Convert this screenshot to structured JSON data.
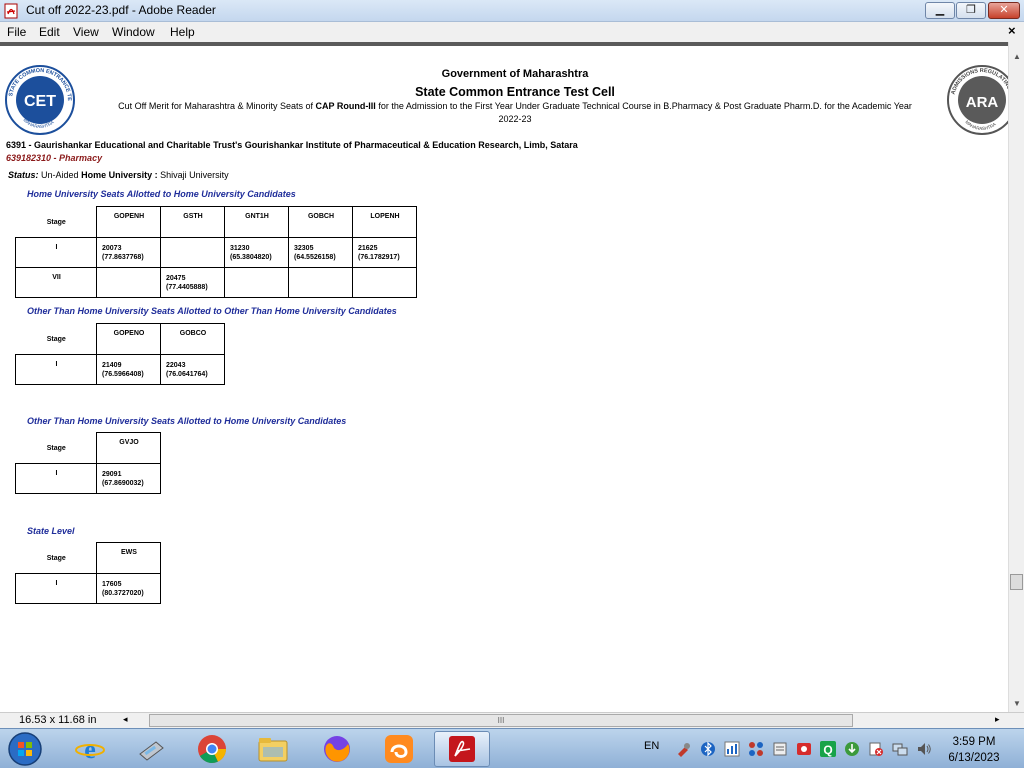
{
  "window": {
    "title": "Cut off 2022-23.pdf - Adobe Reader",
    "minimize": "▁",
    "maximize": "❐",
    "close": "✕"
  },
  "menu": [
    "File",
    "Edit",
    "View",
    "Window",
    "Help"
  ],
  "doc_close": "×",
  "document": {
    "header": {
      "gov": "Government of Maharashtra",
      "cell": "State Common Entrance Test Cell",
      "subtitle_pre": "Cut Off Merit for Maharashtra & Minority Seats of ",
      "subtitle_bold": "CAP Round-III",
      "subtitle_post": " for the Admission to the First Year Under Graduate Technical Course in B.Pharmacy & Post Graduate Pharm.D. for the Academic Year 2022-23"
    },
    "logos": {
      "left_text": "STATE COMMON ENTRANCE TEST CELL",
      "left_mark": "CET",
      "left_bottom": "MAHARASHTRA",
      "right_text": "ADMISSIONS REGULATING",
      "right_mark": "ARA",
      "right_bottom": "MAHARASHTRA"
    },
    "institute": "6391 - Gaurishankar Educational and Charitable Trust's Gourishankar Institute of Pharmaceutical & Education Research, Limb, Satara",
    "course": "639182310 - Pharmacy",
    "status_label": "Status:",
    "status_value": "Un-Aided",
    "home_uni_label": "Home University :",
    "home_uni_value": "Shivaji University",
    "sections": [
      {
        "title": "Home University Seats Allotted to Home University Candidates",
        "stage_label": "Stage",
        "headers": [
          "GOPENH",
          "GSTH",
          "GNT1H",
          "GOBCH",
          "LOPENH"
        ],
        "rows": [
          {
            "stage": "I",
            "cells": [
              [
                "20073",
                "(77.8637768)"
              ],
              [
                "",
                ""
              ],
              [
                "31230",
                "(65.3804820)"
              ],
              [
                "32305",
                "(64.5526158)"
              ],
              [
                "21625",
                "(76.1782917)"
              ]
            ]
          },
          {
            "stage": "VII",
            "cells": [
              [
                "",
                ""
              ],
              [
                "20475",
                "(77.4405888)"
              ],
              [
                "",
                ""
              ],
              [
                "",
                ""
              ],
              [
                "",
                ""
              ]
            ]
          }
        ]
      },
      {
        "title": "Other Than Home University Seats Allotted to Other Than Home University Candidates",
        "stage_label": "Stage",
        "headers": [
          "GOPENO",
          "GOBCO"
        ],
        "rows": [
          {
            "stage": "I",
            "cells": [
              [
                "21409",
                "(76.5966408)"
              ],
              [
                "22043",
                "(76.0641764)"
              ]
            ]
          }
        ]
      },
      {
        "title": "Other Than Home University Seats Allotted to Home University Candidates",
        "stage_label": "Stage",
        "headers": [
          "GVJO"
        ],
        "rows": [
          {
            "stage": "I",
            "cells": [
              [
                "29091",
                "(67.8690032)"
              ]
            ]
          }
        ]
      },
      {
        "title": "State Level",
        "stage_label": "Stage",
        "headers": [
          "EWS"
        ],
        "rows": [
          {
            "stage": "I",
            "cells": [
              [
                "17605",
                "(80.3727020)"
              ]
            ]
          }
        ]
      }
    ]
  },
  "statusbar": {
    "page_size": "16.53 x 11.68 in",
    "scroll_left": "◂",
    "scroll_grip": "III",
    "scroll_right": "▸"
  },
  "taskbar": {
    "apps": [
      "start-orb",
      "internet-explorer",
      "scanner",
      "chrome",
      "file-explorer",
      "firefox",
      "uc-browser",
      "adobe-reader"
    ],
    "active_app": "adobe-reader",
    "language": "EN",
    "time": "3:59 PM",
    "date": "6/13/2023"
  },
  "colors": {
    "section_title": "#1f2d9a",
    "course_text": "#8b1a1a"
  }
}
